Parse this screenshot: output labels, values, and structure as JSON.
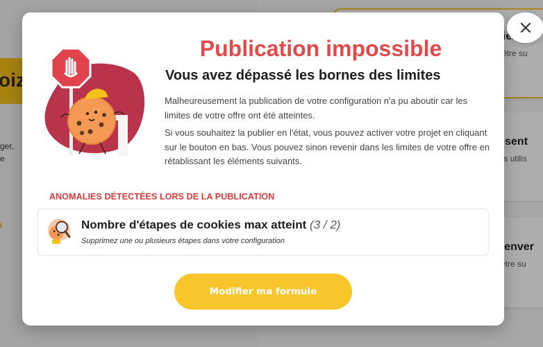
{
  "background": {
    "logo_text": "oiz",
    "left_lines": [
      "ger,",
      "e"
    ],
    "left_link": "i",
    "cards": [
      {
        "title": "bienver",
        "subtitle": "d'être su"
      },
      {
        "title": "résent",
        "subtitle": "ous utilis"
      },
      {
        "title": "bienver",
        "subtitle": "d'être su"
      }
    ]
  },
  "modal": {
    "title": "Publication impossible",
    "subtitle": "Vous avez dépassé les bornes des limites",
    "paragraph1": "Malheureusement la publication de votre configuration n'a pu aboutir car les limites de votre offre ont été atteintes.",
    "paragraph2": "Si vous souhaitez la publier en l'état, vous pouvez activer votre projet en cliquant sur le bouton en bas. Vous pouvez sinon revenir dans les limites de votre offre en rétablissant les éléments suivants.",
    "anomalies_label": "ANOMALIES DÉTECTÉES LORS DE LA PUBLICATION",
    "anomaly": {
      "title": "Nombre d'étapes de cookies max atteint",
      "count": "(3 / 2)",
      "description": "Supprimez une ou plusieurs étapes dans votre configuration"
    },
    "cta_label": "Modifier ma formule"
  },
  "colors": {
    "title_red": "#e04a4a",
    "accent_yellow": "#f8c62b",
    "label_red": "#d63a3a"
  },
  "icons": {
    "close": "close-icon",
    "illustration": "cookie-stop-sign-illustration",
    "anomaly": "cookie-magnifier-icon"
  }
}
